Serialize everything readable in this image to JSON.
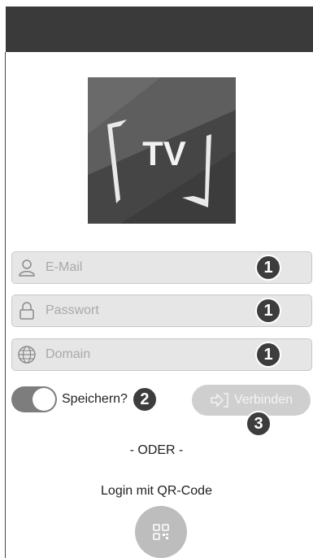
{
  "app": {
    "logo_text": "TV"
  },
  "form": {
    "email": {
      "placeholder": "E-Mail",
      "value": ""
    },
    "password": {
      "placeholder": "Passwort",
      "value": ""
    },
    "domain": {
      "placeholder": "Domain",
      "value": ""
    }
  },
  "remember": {
    "label": "Speichern?",
    "on": true
  },
  "connect": {
    "label": "Verbinden"
  },
  "divider": {
    "text": "- ODER -"
  },
  "qr": {
    "label": "Login mit QR-Code"
  },
  "badges": {
    "fields": "1",
    "remember": "2",
    "connect": "3"
  },
  "colors": {
    "badge": "#3d3d3d",
    "field_bg": "#e6e6e6",
    "topbar": "#3a3a3a",
    "button_disabled": "#cfcfcf"
  }
}
